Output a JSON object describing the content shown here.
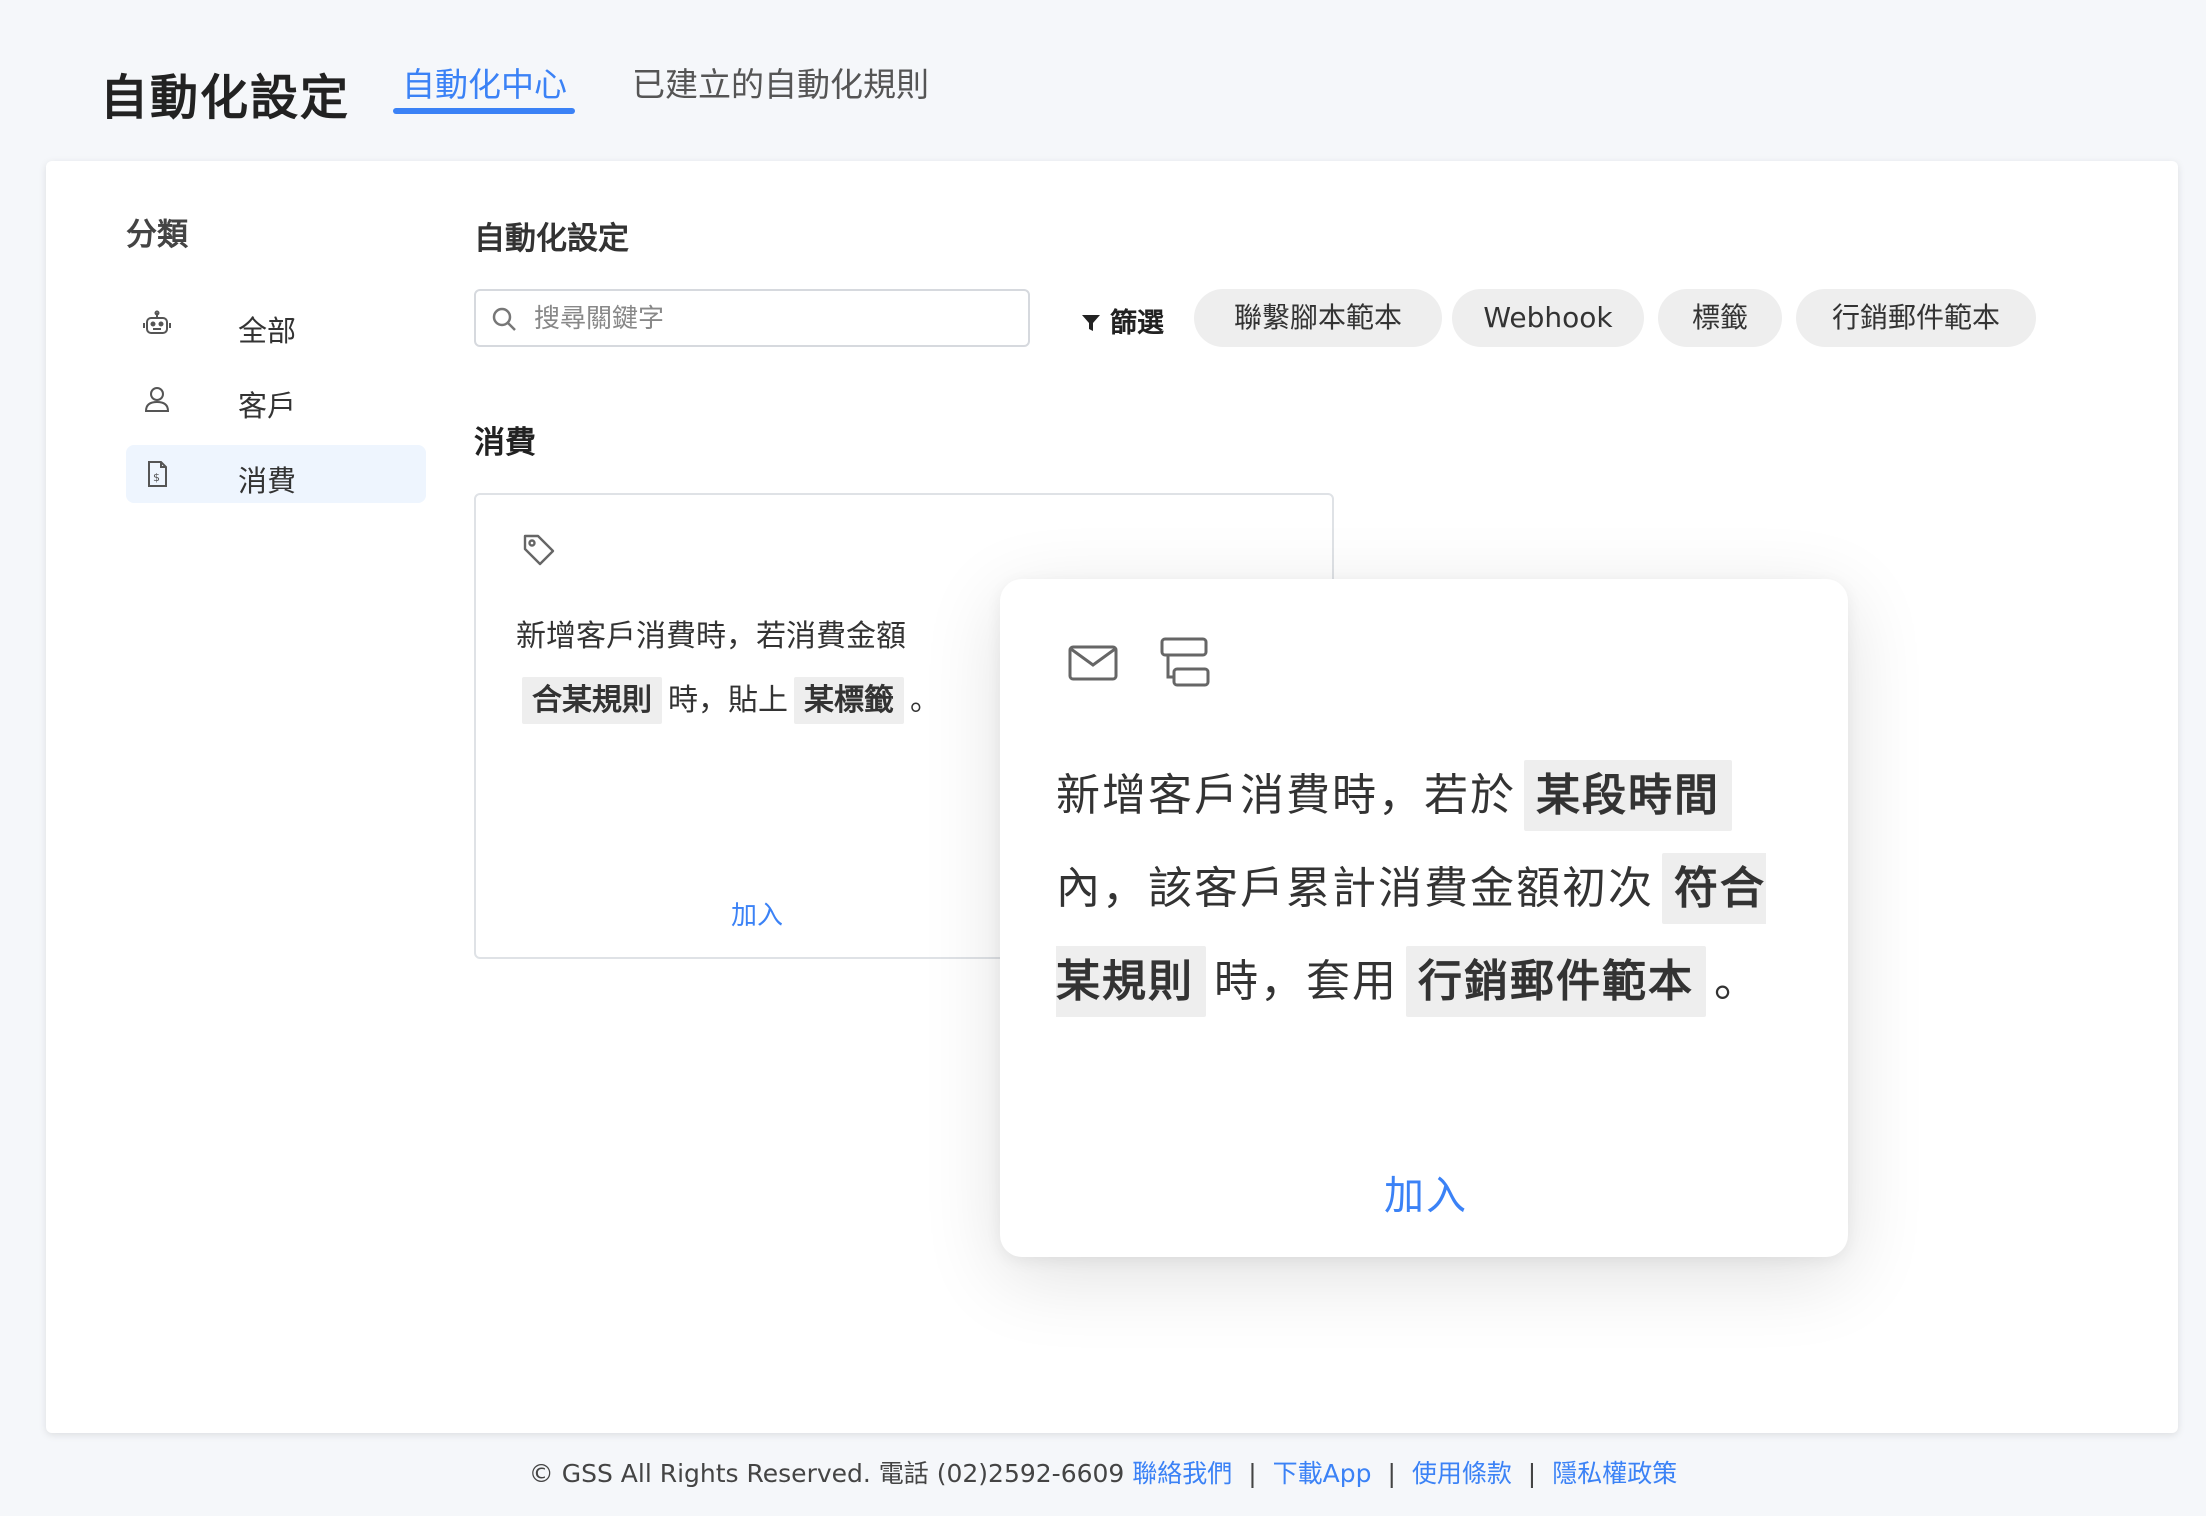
{
  "header": {
    "title": "自動化設定",
    "tabs": [
      "自動化中心",
      "已建立的自動化規則"
    ]
  },
  "sidebar": {
    "heading": "分類",
    "items": [
      {
        "label": "全部",
        "icon": "robot-icon"
      },
      {
        "label": "客戶",
        "icon": "user-icon"
      },
      {
        "label": "消費",
        "icon": "receipt-icon"
      }
    ],
    "active_index": 2
  },
  "main": {
    "section_title": "自動化設定",
    "search_placeholder": "搜尋關鍵字",
    "filter_label": "篩選",
    "chips": [
      "聯繫腳本範本",
      "Webhook",
      "標籤",
      "行銷郵件範本"
    ],
    "category_heading": "消費",
    "card": {
      "text_prefix": "新增客戶消費時，若消費金額",
      "highlight1": "合某規則",
      "text_middle": "時，貼上",
      "highlight2": "某標籤",
      "text_suffix": "。",
      "add_label": "加入"
    }
  },
  "popover": {
    "icons": [
      "mail-icon",
      "workflow-icon"
    ],
    "text1": "新增客戶消費時，若於",
    "highlight1": "某段時間",
    "text2": "內，該客戶累計消費金額初次",
    "highlight2": "符合某規則",
    "text3": "時，套用",
    "highlight3": "行銷郵件範本",
    "text4": "。",
    "add_label": "加入"
  },
  "footer": {
    "copyright": "© GSS All Rights Reserved. 電話 (02)2592-6609",
    "links": [
      "聯絡我們",
      "下載App",
      "使用條款",
      "隱私權政策"
    ],
    "separator": "|"
  },
  "colors": {
    "accent": "#3b82f6",
    "background": "#f5f7fa",
    "highlight_bg": "#eeeeee",
    "active_side_bg": "#eef5fe"
  }
}
